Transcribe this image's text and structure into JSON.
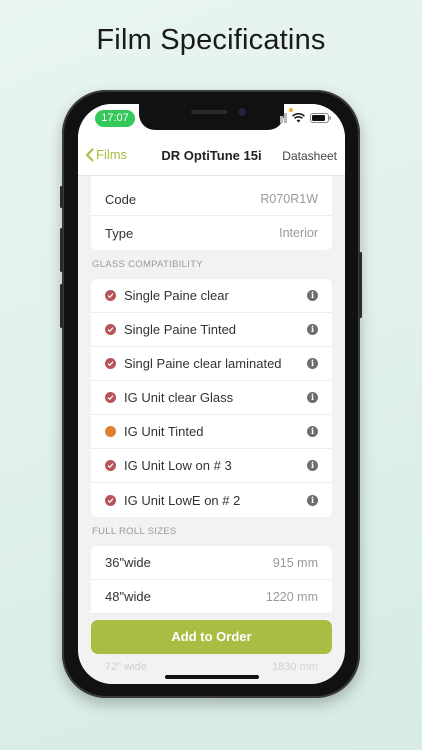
{
  "headline": "Film Specificatins",
  "status_bar": {
    "time": "17:07"
  },
  "nav": {
    "back_label": "Films",
    "title": "DR OptiTune 15i",
    "right_label": "Datasheet"
  },
  "spec_rows": [
    {
      "label": "Code",
      "value": "R070R1W"
    },
    {
      "label": "Type",
      "value": "Interior"
    }
  ],
  "glass": {
    "header": "GLASS COMPATIBILITY",
    "items": [
      {
        "label": "Single Paine clear",
        "status": "check",
        "info": "i"
      },
      {
        "label": "Single Paine Tinted",
        "status": "check",
        "info": "i"
      },
      {
        "label": "Singl Paine clear laminated",
        "status": "check",
        "info": "i"
      },
      {
        "label": "IG Unit clear Glass",
        "status": "check",
        "info": "i"
      },
      {
        "label": "IG Unit Tinted",
        "status": "caution",
        "info": "i"
      },
      {
        "label": "IG Unit Low on # 3",
        "status": "check",
        "info": "i"
      },
      {
        "label": "IG Unit LowE on # 2",
        "status": "check",
        "info": "i"
      }
    ]
  },
  "roll_sizes": {
    "header": "FULL ROLL SIZES",
    "items": [
      {
        "label": "36\"wide",
        "value": "915 mm"
      },
      {
        "label": "48\"wide",
        "value": "1220 mm"
      }
    ],
    "partial": {
      "label": "72\" wide",
      "value": "1830 mm"
    }
  },
  "add_button": "Add to Order",
  "colors": {
    "accent": "#a8be43",
    "check": "#b5555a",
    "caution": "#e08030",
    "status_pill": "#34c759"
  }
}
